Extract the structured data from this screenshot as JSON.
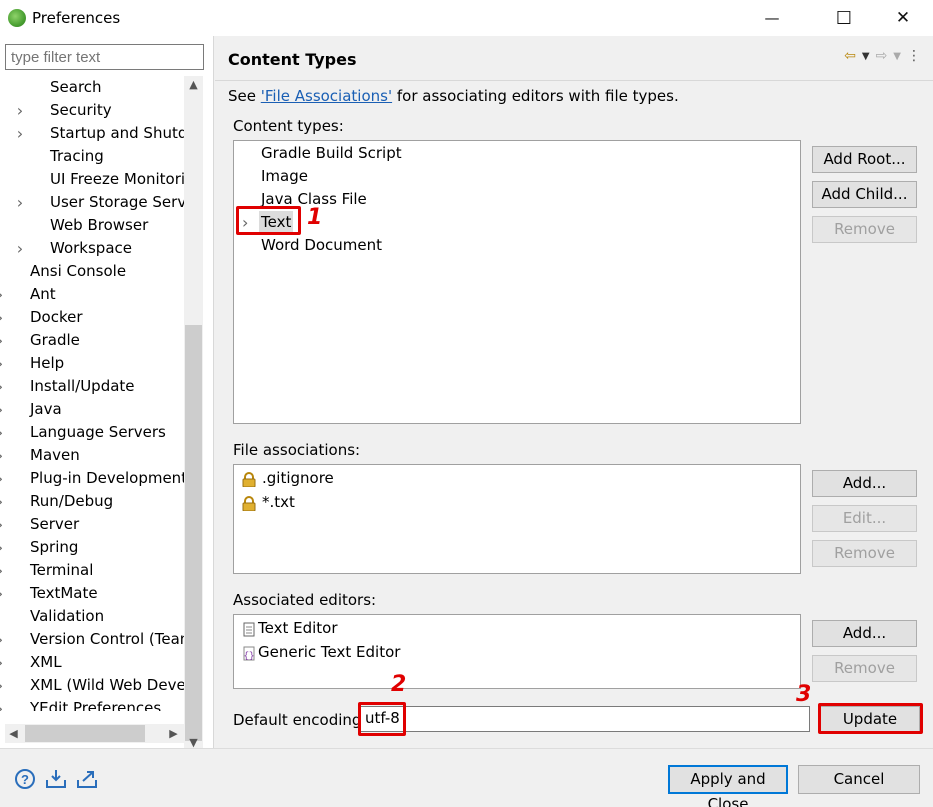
{
  "window": {
    "title": "Preferences",
    "minimize": "—",
    "maximize": "☐",
    "close": "✕"
  },
  "left": {
    "filter_placeholder": "type filter text",
    "tree": [
      {
        "label": "Search",
        "expandable": false,
        "depth": 2
      },
      {
        "label": "Security",
        "expandable": true,
        "depth": 2
      },
      {
        "label": "Startup and Shutdo",
        "expandable": true,
        "depth": 2
      },
      {
        "label": "Tracing",
        "expandable": false,
        "depth": 2
      },
      {
        "label": "UI Freeze Monitorin",
        "expandable": false,
        "depth": 2
      },
      {
        "label": "User Storage Servic",
        "expandable": true,
        "depth": 2
      },
      {
        "label": "Web Browser",
        "expandable": false,
        "depth": 2
      },
      {
        "label": "Workspace",
        "expandable": true,
        "depth": 2
      },
      {
        "label": "Ansi Console",
        "expandable": false,
        "depth": 1
      },
      {
        "label": "Ant",
        "expandable": true,
        "depth": 1
      },
      {
        "label": "Docker",
        "expandable": true,
        "depth": 1
      },
      {
        "label": "Gradle",
        "expandable": true,
        "depth": 1
      },
      {
        "label": "Help",
        "expandable": true,
        "depth": 1
      },
      {
        "label": "Install/Update",
        "expandable": true,
        "depth": 1
      },
      {
        "label": "Java",
        "expandable": true,
        "depth": 1
      },
      {
        "label": "Language Servers",
        "expandable": true,
        "depth": 1
      },
      {
        "label": "Maven",
        "expandable": true,
        "depth": 1
      },
      {
        "label": "Plug-in Development",
        "expandable": true,
        "depth": 1
      },
      {
        "label": "Run/Debug",
        "expandable": true,
        "depth": 1
      },
      {
        "label": "Server",
        "expandable": true,
        "depth": 1
      },
      {
        "label": "Spring",
        "expandable": true,
        "depth": 1
      },
      {
        "label": "Terminal",
        "expandable": true,
        "depth": 1
      },
      {
        "label": "TextMate",
        "expandable": true,
        "depth": 1
      },
      {
        "label": "Validation",
        "expandable": false,
        "depth": 1
      },
      {
        "label": "Version Control (Team",
        "expandable": true,
        "depth": 1
      },
      {
        "label": "XML",
        "expandable": true,
        "depth": 1
      },
      {
        "label": "XML (Wild Web Develo",
        "expandable": true,
        "depth": 1
      },
      {
        "label": "YEdit Preferences",
        "expandable": true,
        "depth": 1
      }
    ]
  },
  "main": {
    "title": "Content Types",
    "desc_prefix": "See ",
    "desc_link": "'File Associations'",
    "desc_suffix": " for associating editors with file types.",
    "content_types_label": "Content types:",
    "content_types": [
      {
        "label": "Gradle Build Script",
        "expandable": false
      },
      {
        "label": "Image",
        "expandable": false
      },
      {
        "label": "Java Class File",
        "expandable": false
      },
      {
        "label": "Text",
        "expandable": true,
        "selected": true
      },
      {
        "label": "Word Document",
        "expandable": false
      }
    ],
    "add_root": "Add Root...",
    "add_child": "Add Child...",
    "remove": "Remove",
    "file_assoc_label": "File associations:",
    "file_assoc": [
      ".gitignore",
      "*.txt"
    ],
    "add": "Add...",
    "edit": "Edit...",
    "assoc_editors_label": "Associated editors:",
    "assoc_editors": [
      "Text Editor",
      "Generic Text Editor"
    ],
    "default_encoding_label": "Default encoding:",
    "default_encoding_value": "utf-8",
    "update": "Update"
  },
  "annotations": [
    "1",
    "2",
    "3"
  ],
  "footer": {
    "apply_close": "Apply and Close",
    "cancel": "Cancel"
  }
}
